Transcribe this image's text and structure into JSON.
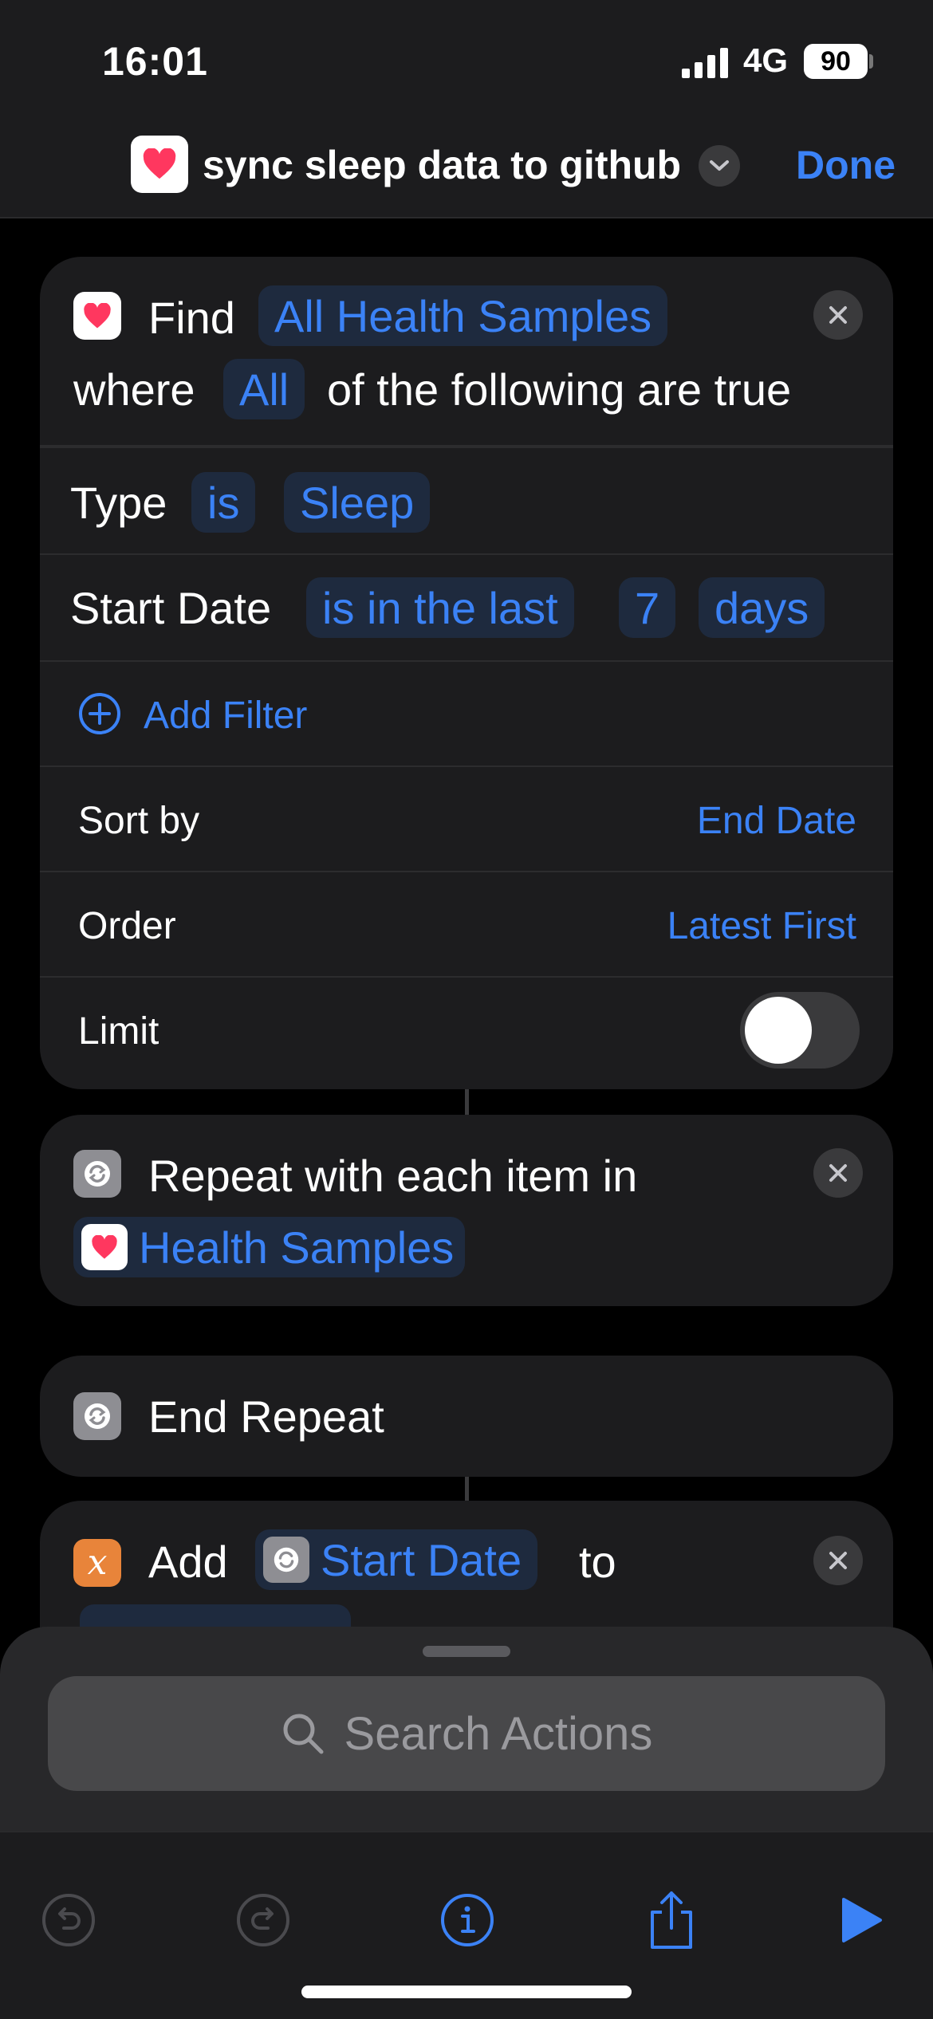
{
  "status": {
    "time": "16:01",
    "network": "4G",
    "battery": "90"
  },
  "header": {
    "title": "sync sleep data to github",
    "done_label": "Done"
  },
  "find_action": {
    "verb": "Find",
    "sample_type": "All Health Samples",
    "where_label": "where",
    "match": "All",
    "condition_text": "of the following are true",
    "filters": [
      {
        "field": "Type",
        "operator": "is",
        "value": "Sleep"
      },
      {
        "field": "Start Date",
        "operator": "is in the last",
        "amount": "7",
        "unit": "days"
      }
    ],
    "add_filter_label": "Add Filter",
    "sort_by_label": "Sort by",
    "sort_by_value": "End Date",
    "order_label": "Order",
    "order_value": "Latest First",
    "limit_label": "Limit",
    "limit_enabled": false
  },
  "repeat_action": {
    "label": "Repeat with each item in",
    "variable": "Health Samples"
  },
  "end_repeat": {
    "label": "End Repeat"
  },
  "add_action": {
    "verb": "Add",
    "variable": "Start Date",
    "to_label": "to"
  },
  "search": {
    "placeholder": "Search Actions"
  },
  "icons": {
    "health": "heart-icon",
    "repeat": "repeat-icon",
    "variable": "variable-x-icon",
    "undo": "undo-icon",
    "redo": "redo-icon",
    "info": "info-icon",
    "share": "share-icon",
    "run": "play-icon"
  },
  "colors": {
    "accent": "#3b82f6",
    "heart": "#ff375f",
    "variable": "#e8843a",
    "background": "#000000",
    "card": "#1c1c1e"
  }
}
